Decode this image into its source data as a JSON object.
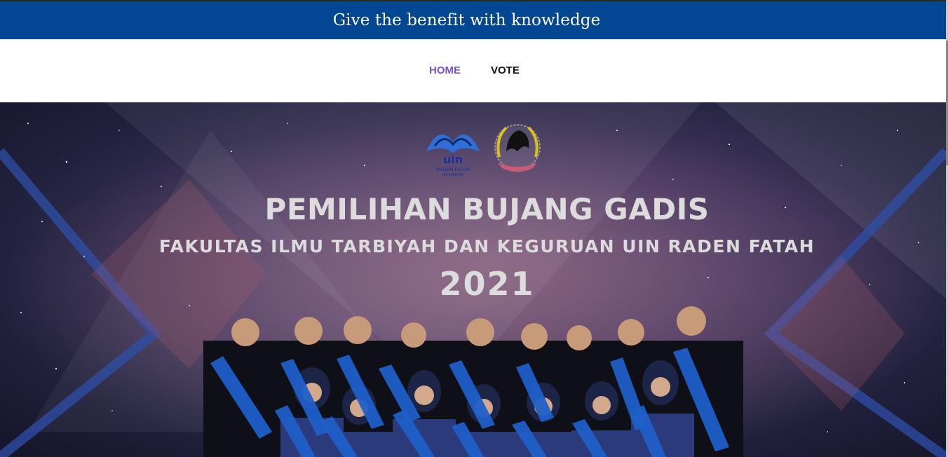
{
  "header": {
    "tagline": "Give the benefit with knowledge"
  },
  "nav": {
    "items": [
      {
        "label": "HOME",
        "active": true
      },
      {
        "label": "VOTE",
        "active": false
      }
    ]
  },
  "hero": {
    "logo_text_line1": "uin",
    "logo_text_line2": "RADEN FATAH",
    "logo_text_line3": "PALEMBANG",
    "title": "PEMILIHAN BUJANG GADIS",
    "subtitle": "FAKULTAS ILMU TARBIYAH DAN KEGURUAN UIN RADEN FATAH",
    "year": "2021",
    "image_description_icon": "group-photo"
  },
  "colors": {
    "header_bg": "#034792",
    "nav_active": "#7b4fd6",
    "nav_default": "#111111",
    "hero_text": "#dcdcdc",
    "sash": "#1f5fc9"
  }
}
